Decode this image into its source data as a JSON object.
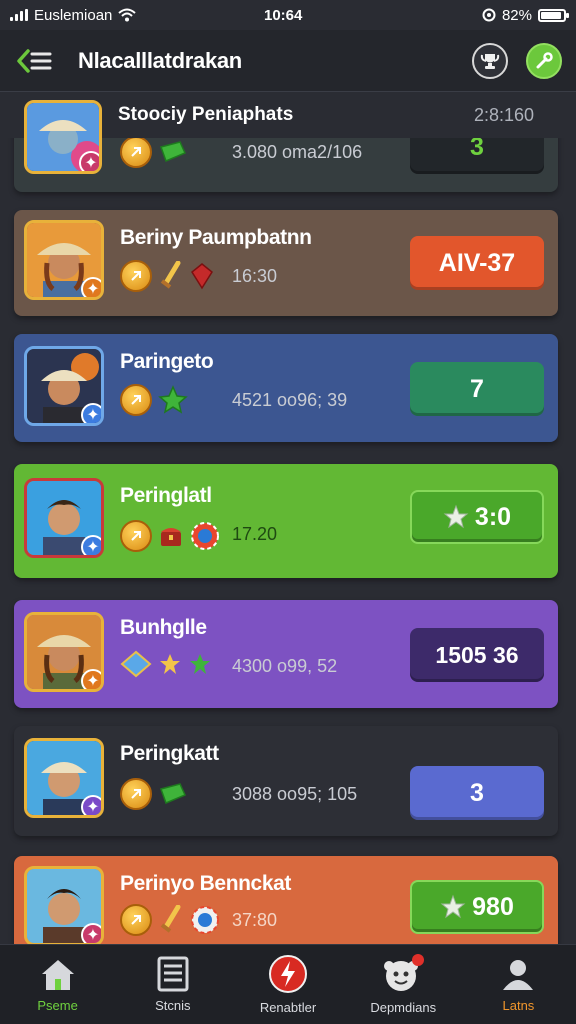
{
  "status_bar": {
    "carrier": "Euslemioan",
    "time": "10:64",
    "battery": "82%",
    "battery_level": 0.82
  },
  "header": {
    "title": "Nlacalllatdrakan"
  },
  "subheader": {
    "title": "Stoociy Peniaphats",
    "value": "2:8:160"
  },
  "colors": {
    "background": "#2a2c33",
    "accent_green": "#6cc83c",
    "card_brown": "#6b5649",
    "card_blue": "#3c5691",
    "card_green": "#62b834",
    "card_purple": "#7d52c2",
    "card_dark": "#2d2f36",
    "card_orange": "#d8693e"
  },
  "rows": [
    {
      "name": "",
      "stat": "3.080 oma2/106",
      "score": "3",
      "icons": [
        "coin-icon",
        "gem-green-icon"
      ]
    },
    {
      "name": "Beriny Paumpbatnn",
      "stat": "16:30",
      "score": "AIV-37",
      "icons": [
        "coin-icon",
        "sword-icon",
        "gem-red-icon"
      ]
    },
    {
      "name": "Paringeto",
      "stat": "4521 oo96; 39",
      "score": "7",
      "icons": [
        "coin-icon",
        "star-green-icon"
      ]
    },
    {
      "name": "Peringlatl",
      "stat": "17.20",
      "score": "3:0",
      "icons": [
        "coin-icon",
        "chest-icon",
        "chip-icon"
      ]
    },
    {
      "name": "Bunhglle",
      "stat": "4300 o99, 52",
      "score": "1505 36",
      "icons": [
        "crystal-icon",
        "star-yellow-icon",
        "star-green-icon"
      ]
    },
    {
      "name": "Peringkatt",
      "stat": "3088 oo95; 105",
      "score": "3",
      "icons": [
        "coin-icon",
        "gem-green-icon"
      ]
    },
    {
      "name": "Perinyo Bennckat",
      "stat": "37:80",
      "score": "980",
      "icons": [
        "coin-icon",
        "sword-icon",
        "chip-icon"
      ]
    }
  ],
  "nav": [
    {
      "label": "Pseme",
      "icon": "home-icon"
    },
    {
      "label": "Stcnis",
      "icon": "list-icon"
    },
    {
      "label": "Renabtler",
      "icon": "lightning-icon"
    },
    {
      "label": "Depmdians",
      "icon": "mascot-icon"
    },
    {
      "label": "Latns",
      "icon": "profile-icon"
    }
  ]
}
